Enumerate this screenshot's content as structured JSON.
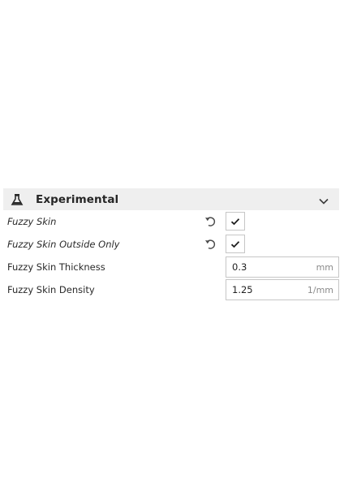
{
  "section": {
    "title": "Experimental",
    "icon": "flask-icon",
    "chevron_icon": "chevron-down-icon"
  },
  "settings": [
    {
      "label": "Fuzzy Skin",
      "type": "checkbox",
      "checked": true,
      "reset_icon": "reset-icon"
    },
    {
      "label": "Fuzzy Skin Outside Only",
      "type": "checkbox",
      "checked": true,
      "reset_icon": "reset-icon"
    },
    {
      "label": "Fuzzy Skin Thickness",
      "type": "number",
      "value": "0.3",
      "unit": "mm"
    },
    {
      "label": "Fuzzy Skin Density",
      "type": "number",
      "value": "1.25",
      "unit": "1/mm"
    }
  ],
  "colors": {
    "header_bg": "#efefef",
    "field_border": "#c6c6c6",
    "unit_text": "#8a8a8a"
  }
}
